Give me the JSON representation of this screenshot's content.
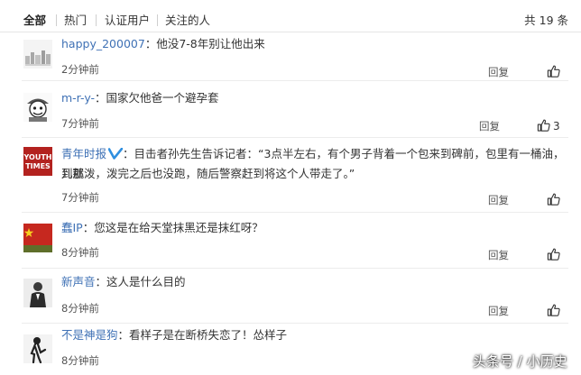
{
  "tabs": [
    "全部",
    "热门",
    "认证用户",
    "关注的人"
  ],
  "total": "共 19 条",
  "reply_label": "回复",
  "comments": [
    {
      "user": "happy_200007",
      "sep": "：",
      "text": "他没7-8年别让他出来",
      "time": "2分钟前",
      "likes": ""
    },
    {
      "user": "m-r-y-",
      "sep": "：",
      "text": "国家欠他爸一个避孕套",
      "time": "7分钟前",
      "likes": "3"
    },
    {
      "user": "青年时报",
      "sep": "：",
      "text_line1": "目击者孙先生告诉记者：“3点半左右，有个男子背着一个包来到碑前，包里有一桶油，到那",
      "text_line2": "儿就泼，泼完之后也没跑，随后警察赶到将这个人带走了。”",
      "time": "7分钟前",
      "likes": "",
      "verified": true
    },
    {
      "user": "蠢IP",
      "sep": "：",
      "text": "您这是在给天堂抹黑还是抹红呀？",
      "time": "8分钟前",
      "likes": ""
    },
    {
      "user": "新声音",
      "sep": "：",
      "text": "这人是什么目的",
      "time": "8分钟前",
      "likes": ""
    },
    {
      "user": "不是神是狗",
      "sep": "：",
      "text": "看样子是在断桥失恋了！怂样子",
      "time": "8分钟前",
      "likes": ""
    }
  ],
  "avatar_text": {
    "qingnian": "YOUTH TIMES"
  },
  "watermark": "头条号 / 小历史",
  "colors": {
    "link": "#3f71b5",
    "verified": "#2f8fe0"
  },
  "icons": [
    "thumbs-up-icon",
    "verified-v-icon"
  ]
}
